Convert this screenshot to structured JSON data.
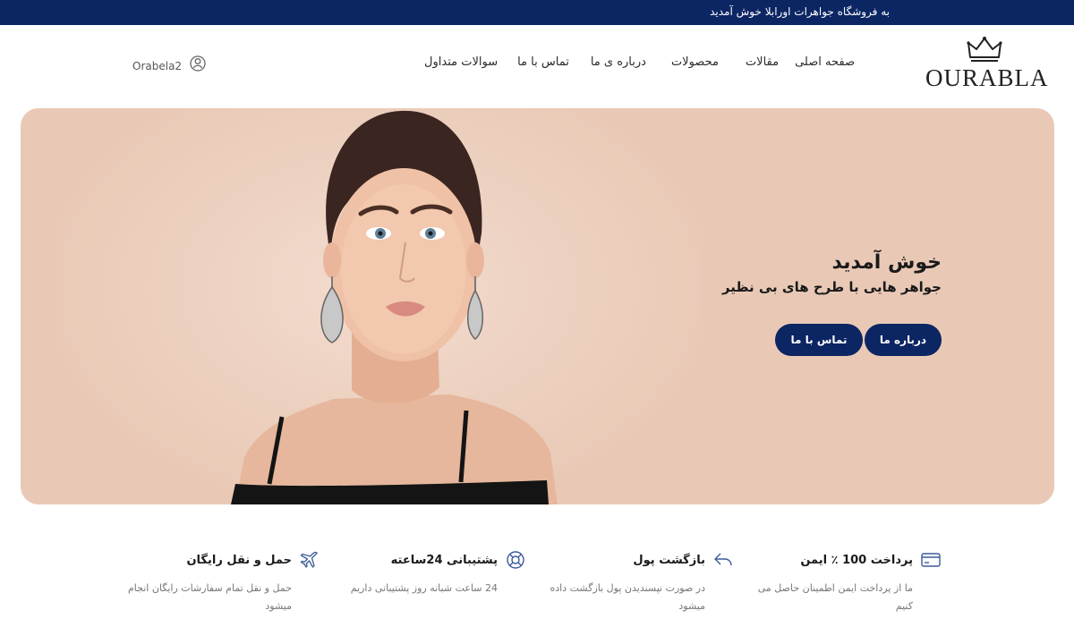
{
  "topbar": {
    "welcome": "به فروشگاه جواهرات اورابلا خوش آمدید"
  },
  "brand": {
    "logo_text": "OURABLA",
    "logo_icon": "crown-icon"
  },
  "nav": {
    "items": [
      "صفحه اصلی",
      "مقالات",
      "محصولات",
      "درباره ی ما",
      "تماس با ما",
      "سوالات متداول"
    ]
  },
  "account": {
    "label": "Orabela2",
    "icon": "user-icon"
  },
  "hero": {
    "title": "خوش آمدید",
    "subtitle": "جواهر هایی با طرح های بی نظیر",
    "about_button": "درباره ما",
    "contact_button": "تماس با ما",
    "background": "#e9c9b6"
  },
  "features": [
    {
      "icon": "credit-card-icon",
      "title": "پرداخت 100 ٪ ایمن",
      "desc": "ما از پرداخت ایمن اطمینان حاصل می کنیم"
    },
    {
      "icon": "undo-arrow-icon",
      "title": "بازگشت پول",
      "desc": "در صورت نپسندیدن پول بازگشت داده میشود"
    },
    {
      "icon": "lifebuoy-icon",
      "title": "پشتیبانی 24ساعته",
      "desc": "24 ساعت شبانه روز پشتیبانی داریم"
    },
    {
      "icon": "airplane-icon",
      "title": "حمل و نقل رایگان",
      "desc": "حمل و نقل تمام سفارشات رایگان انجام میشود"
    }
  ],
  "colors": {
    "primary": "#0c2563",
    "hero_bg": "#e9c9b6"
  }
}
